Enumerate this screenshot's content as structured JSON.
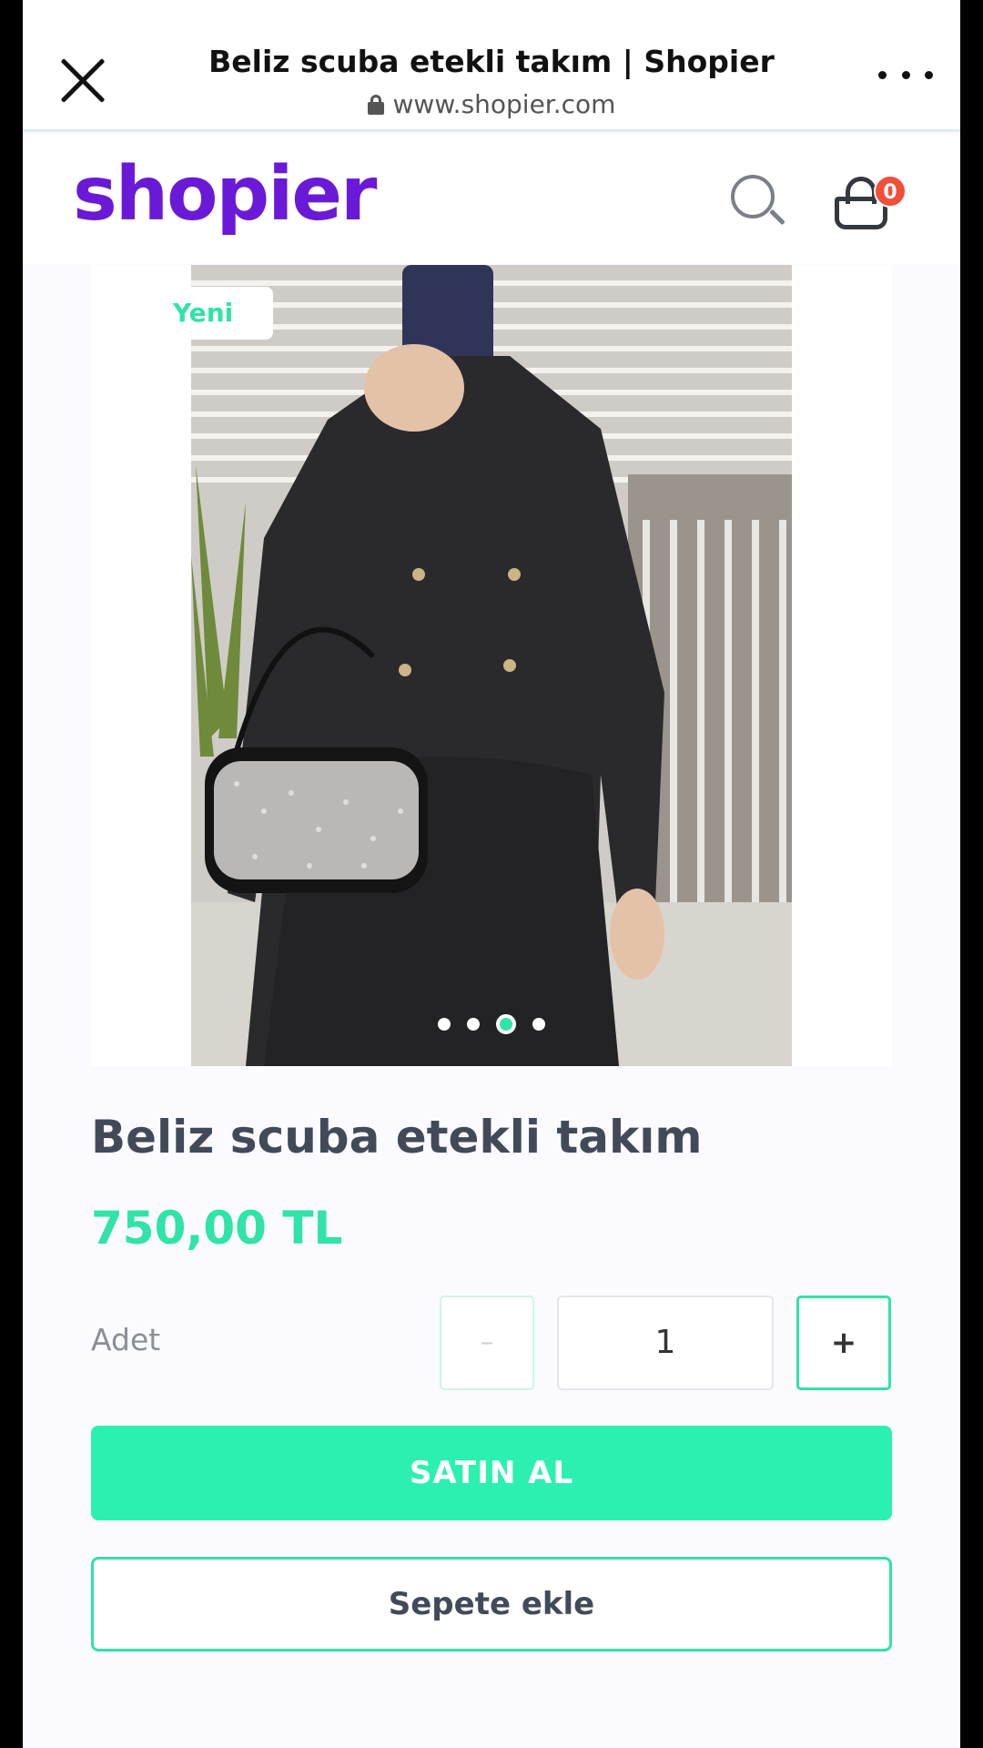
{
  "browser": {
    "title": "Beliz scuba etekli takım | Shopier",
    "url": "www.shopier.com"
  },
  "header": {
    "logo": "shopier",
    "cart_count": "0"
  },
  "gallery": {
    "badge": "Yeni",
    "image_count": 4,
    "active_index": 2
  },
  "product": {
    "name": "Beliz scuba etekli takım",
    "price": "750,00 TL"
  },
  "quantity": {
    "label": "Adet",
    "minus": "–",
    "value": "1",
    "plus": "+"
  },
  "actions": {
    "buy": "SATIN AL",
    "add_to_cart": "Sepete ekle"
  },
  "colors": {
    "brand": "#6a1ad6",
    "accent": "#2cf0b0",
    "badge": "#f04f3a"
  }
}
